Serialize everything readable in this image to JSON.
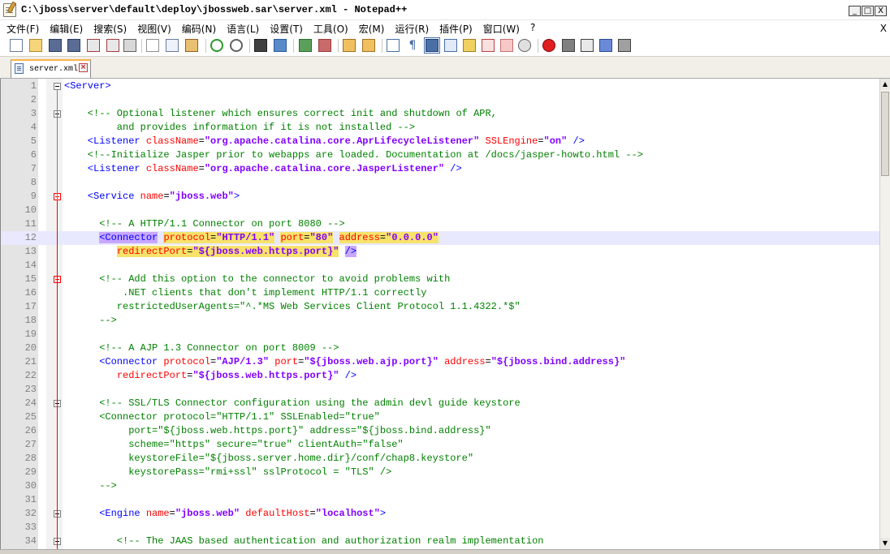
{
  "window": {
    "title": "C:\\jboss\\server\\default\\deploy\\jbossweb.sar\\server.xml - Notepad++",
    "minimize": "_",
    "maximize": "□",
    "close": "X"
  },
  "menu": {
    "items": [
      "文件(F)",
      "编辑(E)",
      "搜索(S)",
      "视图(V)",
      "编码(N)",
      "语言(L)",
      "设置(T)",
      "工具(O)",
      "宏(M)",
      "运行(R)",
      "插件(P)",
      "窗口(W)",
      "?"
    ],
    "close": "X"
  },
  "toolbar": {
    "icons": [
      "new-file-icon",
      "open-file-icon",
      "save-icon",
      "save-all-icon",
      "close-icon",
      "close-all-icon",
      "print-icon",
      "cut-icon",
      "copy-icon",
      "paste-icon",
      "undo-icon",
      "redo-icon",
      "find-icon",
      "replace-icon",
      "zoom-in-icon",
      "zoom-out-icon",
      "sync-vertical-icon",
      "sync-horizontal-icon",
      "word-wrap-icon",
      "show-all-chars-icon",
      "indent-guide-icon",
      "user-language-icon",
      "doc-map-icon",
      "function-list-icon",
      "folder-workspace-icon",
      "monitor-icon",
      "record-macro-icon",
      "stop-record-icon",
      "play-macro-icon",
      "run-macro-multiple-icon",
      "save-macro-icon"
    ]
  },
  "tab": {
    "label": "server.xml"
  },
  "editor": {
    "current_line": 12,
    "lines": [
      {
        "n": "1",
        "segs": [
          {
            "t": "<Server>",
            "c": "tag"
          }
        ]
      },
      {
        "n": "2",
        "segs": []
      },
      {
        "n": "3",
        "segs": [
          {
            "t": "    <!-- Optional listener which ensures correct init and shutdown of APR,",
            "c": "cmt"
          }
        ]
      },
      {
        "n": "4",
        "segs": [
          {
            "t": "         and provides information if it is not installed -->",
            "c": "cmt"
          }
        ]
      },
      {
        "n": "5",
        "segs": [
          {
            "t": "    <Listener ",
            "c": "tag"
          },
          {
            "t": "className",
            "c": "attr"
          },
          {
            "t": "=",
            "c": "plain"
          },
          {
            "t": "\"org.apache.catalina.core.AprLifecycleListener\"",
            "c": "val"
          },
          {
            "t": " SSLEngine",
            "c": "attr"
          },
          {
            "t": "=",
            "c": "plain"
          },
          {
            "t": "\"on\"",
            "c": "val"
          },
          {
            "t": " />",
            "c": "tag"
          }
        ]
      },
      {
        "n": "6",
        "segs": [
          {
            "t": "    <!--Initialize Jasper prior to webapps are loaded. Documentation at /docs/jasper-howto.html -->",
            "c": "cmt"
          }
        ]
      },
      {
        "n": "7",
        "segs": [
          {
            "t": "    <Listener ",
            "c": "tag"
          },
          {
            "t": "className",
            "c": "attr"
          },
          {
            "t": "=",
            "c": "plain"
          },
          {
            "t": "\"org.apache.catalina.core.JasperListener\"",
            "c": "val"
          },
          {
            "t": " />",
            "c": "tag"
          }
        ]
      },
      {
        "n": "8",
        "segs": []
      },
      {
        "n": "9",
        "segs": [
          {
            "t": "    <Service ",
            "c": "tag"
          },
          {
            "t": "name",
            "c": "attr"
          },
          {
            "t": "=",
            "c": "plain"
          },
          {
            "t": "\"jboss.web\"",
            "c": "val"
          },
          {
            "t": ">",
            "c": "tag"
          }
        ]
      },
      {
        "n": "10",
        "segs": []
      },
      {
        "n": "11",
        "segs": [
          {
            "t": "      <!-- A HTTP/1.1 Connector on port 8080 -->",
            "c": "cmt"
          }
        ]
      },
      {
        "n": "12",
        "segs": [
          {
            "t": "      ",
            "c": "plain"
          },
          {
            "t": "<Connector",
            "c": "tag",
            "hl": "hl2"
          },
          {
            "t": " ",
            "c": "plain"
          },
          {
            "t": "protocol",
            "c": "attr",
            "hl": "hl"
          },
          {
            "t": "=",
            "c": "plain",
            "hl": "hl"
          },
          {
            "t": "\"HTTP/1.1\"",
            "c": "val",
            "hl": "hl"
          },
          {
            "t": " ",
            "c": "plain"
          },
          {
            "t": "port",
            "c": "attr",
            "hl": "hl"
          },
          {
            "t": "=",
            "c": "plain",
            "hl": "hl"
          },
          {
            "t": "\"80\"",
            "c": "val",
            "hl": "hl"
          },
          {
            "t": " ",
            "c": "plain"
          },
          {
            "t": "address",
            "c": "attr",
            "hl": "hl"
          },
          {
            "t": "=",
            "c": "plain",
            "hl": "hl"
          },
          {
            "t": "\"0.0.0.0\"",
            "c": "val",
            "hl": "hl"
          }
        ]
      },
      {
        "n": "13",
        "segs": [
          {
            "t": "         ",
            "c": "plain"
          },
          {
            "t": "redirectPort",
            "c": "attr",
            "hl": "hl"
          },
          {
            "t": "=",
            "c": "plain",
            "hl": "hl"
          },
          {
            "t": "\"${jboss.web.https.port}\"",
            "c": "val",
            "hl": "hl"
          },
          {
            "t": " ",
            "c": "plain"
          },
          {
            "t": "/>",
            "c": "tag",
            "hl": "hl2"
          }
        ]
      },
      {
        "n": "14",
        "segs": []
      },
      {
        "n": "15",
        "segs": [
          {
            "t": "      <!-- Add this option to the connector to avoid problems with",
            "c": "cmt"
          }
        ]
      },
      {
        "n": "16",
        "segs": [
          {
            "t": "          .NET clients that don't implement HTTP/1.1 correctly",
            "c": "cmt"
          }
        ]
      },
      {
        "n": "17",
        "segs": [
          {
            "t": "         restrictedUserAgents=\"^.*MS Web Services Client Protocol 1.1.4322.*$\"",
            "c": "cmt"
          }
        ]
      },
      {
        "n": "18",
        "segs": [
          {
            "t": "      -->",
            "c": "cmt"
          }
        ]
      },
      {
        "n": "19",
        "segs": []
      },
      {
        "n": "20",
        "segs": [
          {
            "t": "      <!-- A AJP 1.3 Connector on port 8009 -->",
            "c": "cmt"
          }
        ]
      },
      {
        "n": "21",
        "segs": [
          {
            "t": "      <Connector ",
            "c": "tag"
          },
          {
            "t": "protocol",
            "c": "attr"
          },
          {
            "t": "=",
            "c": "plain"
          },
          {
            "t": "\"AJP/1.3\"",
            "c": "val"
          },
          {
            "t": " port",
            "c": "attr"
          },
          {
            "t": "=",
            "c": "plain"
          },
          {
            "t": "\"${jboss.web.ajp.port}\"",
            "c": "val"
          },
          {
            "t": " address",
            "c": "attr"
          },
          {
            "t": "=",
            "c": "plain"
          },
          {
            "t": "\"${jboss.bind.address}\"",
            "c": "val"
          }
        ]
      },
      {
        "n": "22",
        "segs": [
          {
            "t": "         ",
            "c": "plain"
          },
          {
            "t": "redirectPort",
            "c": "attr"
          },
          {
            "t": "=",
            "c": "plain"
          },
          {
            "t": "\"${jboss.web.https.port}\"",
            "c": "val"
          },
          {
            "t": " />",
            "c": "tag"
          }
        ]
      },
      {
        "n": "23",
        "segs": []
      },
      {
        "n": "24",
        "segs": [
          {
            "t": "      <!-- SSL/TLS Connector configuration using the admin devl guide keystore",
            "c": "cmt"
          }
        ]
      },
      {
        "n": "25",
        "segs": [
          {
            "t": "      <Connector protocol=\"HTTP/1.1\" SSLEnabled=\"true\"",
            "c": "cmt"
          }
        ]
      },
      {
        "n": "26",
        "segs": [
          {
            "t": "           port=\"${jboss.web.https.port}\" address=\"${jboss.bind.address}\"",
            "c": "cmt"
          }
        ]
      },
      {
        "n": "27",
        "segs": [
          {
            "t": "           scheme=\"https\" secure=\"true\" clientAuth=\"false\"",
            "c": "cmt"
          }
        ]
      },
      {
        "n": "28",
        "segs": [
          {
            "t": "           keystoreFile=\"${jboss.server.home.dir}/conf/chap8.keystore\"",
            "c": "cmt"
          }
        ]
      },
      {
        "n": "29",
        "segs": [
          {
            "t": "           keystorePass=\"rmi+ssl\" sslProtocol = \"TLS\" />",
            "c": "cmt"
          }
        ]
      },
      {
        "n": "30",
        "segs": [
          {
            "t": "      -->",
            "c": "cmt"
          }
        ]
      },
      {
        "n": "31",
        "segs": []
      },
      {
        "n": "32",
        "segs": [
          {
            "t": "      <Engine ",
            "c": "tag"
          },
          {
            "t": "name",
            "c": "attr"
          },
          {
            "t": "=",
            "c": "plain"
          },
          {
            "t": "\"jboss.web\"",
            "c": "val"
          },
          {
            "t": " defaultHost",
            "c": "attr"
          },
          {
            "t": "=",
            "c": "plain"
          },
          {
            "t": "\"localhost\"",
            "c": "val"
          },
          {
            "t": ">",
            "c": "tag"
          }
        ]
      },
      {
        "n": "33",
        "segs": []
      },
      {
        "n": "34",
        "segs": [
          {
            "t": "         <!-- The JAAS based authentication and authorization realm implementation",
            "c": "cmt"
          }
        ]
      }
    ]
  },
  "scrollbar": {
    "up": "▲",
    "down": "▼"
  }
}
